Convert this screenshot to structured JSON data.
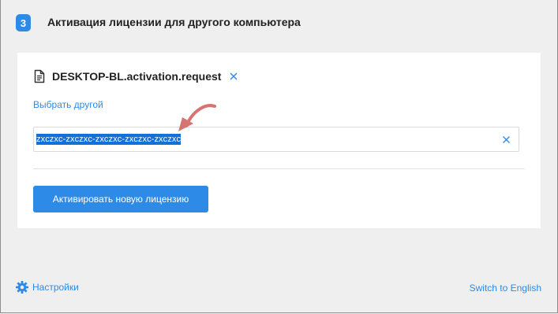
{
  "step": {
    "number": "3",
    "title": "Активация лицензии для другого компьютера"
  },
  "file": {
    "name": "DESKTOP-BL.activation.request",
    "icon": "document-icon",
    "remove_icon": "close-icon"
  },
  "choose_other_label": "Выбрать другой",
  "code_field": {
    "value": "zxczxc-zxczxc-zxczxc-zxczxc-zxczxc",
    "clear_icon": "close-icon"
  },
  "activate_button_label": "Активировать новую лицензию",
  "footer": {
    "settings_label": "Настройки",
    "settings_icon": "gear-icon",
    "language_switch_label": "Switch to English"
  },
  "colors": {
    "accent": "#2d8ae6",
    "selection": "#1370d8",
    "arrow": "#d67373",
    "background": "#efefef"
  }
}
